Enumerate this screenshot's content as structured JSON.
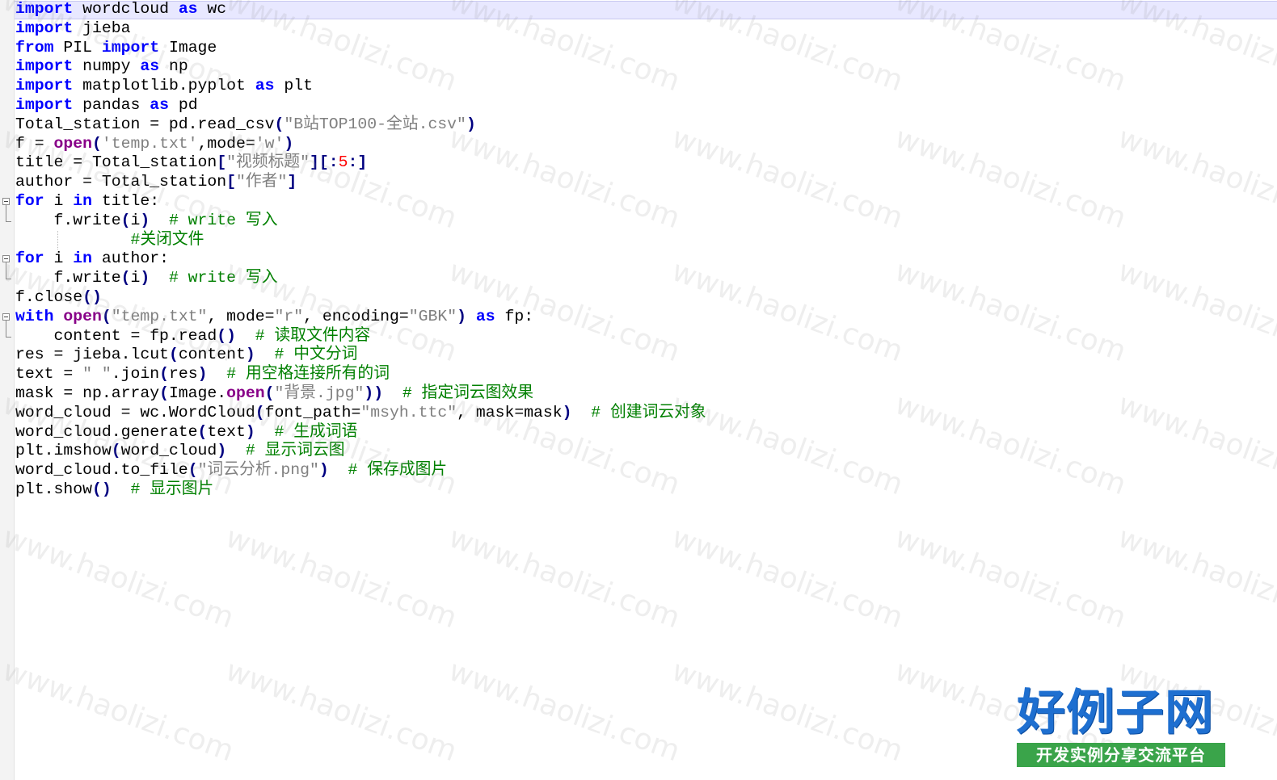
{
  "code_lines": [
    [
      {
        "t": "import",
        "c": "kw"
      },
      {
        "t": " wordcloud ",
        "c": "id"
      },
      {
        "t": "as",
        "c": "kw"
      },
      {
        "t": " wc",
        "c": "id"
      }
    ],
    [
      {
        "t": "import",
        "c": "kw"
      },
      {
        "t": " jieba",
        "c": "id"
      }
    ],
    [
      {
        "t": "from",
        "c": "kw"
      },
      {
        "t": " PIL ",
        "c": "id"
      },
      {
        "t": "import",
        "c": "kw"
      },
      {
        "t": " Image",
        "c": "id"
      }
    ],
    [
      {
        "t": "import",
        "c": "kw"
      },
      {
        "t": " numpy ",
        "c": "id"
      },
      {
        "t": "as",
        "c": "kw"
      },
      {
        "t": " np",
        "c": "id"
      }
    ],
    [
      {
        "t": "import",
        "c": "kw"
      },
      {
        "t": " matplotlib.pyplot ",
        "c": "id"
      },
      {
        "t": "as",
        "c": "kw"
      },
      {
        "t": " plt",
        "c": "id"
      }
    ],
    [
      {
        "t": "import",
        "c": "kw"
      },
      {
        "t": " pandas ",
        "c": "id"
      },
      {
        "t": "as",
        "c": "kw"
      },
      {
        "t": " pd",
        "c": "id"
      }
    ],
    [
      {
        "t": "Total_station = pd.read_csv",
        "c": "id"
      },
      {
        "t": "(",
        "c": "op"
      },
      {
        "t": "\"B站TOP100-全站.csv\"",
        "c": "str"
      },
      {
        "t": ")",
        "c": "op"
      }
    ],
    [
      {
        "t": "f = ",
        "c": "id"
      },
      {
        "t": "open",
        "c": "bi"
      },
      {
        "t": "(",
        "c": "op"
      },
      {
        "t": "'temp.txt'",
        "c": "str"
      },
      {
        "t": ",mode=",
        "c": "id"
      },
      {
        "t": "'w'",
        "c": "str"
      },
      {
        "t": ")",
        "c": "op"
      }
    ],
    [
      {
        "t": "title = Total_station",
        "c": "id"
      },
      {
        "t": "[",
        "c": "op"
      },
      {
        "t": "\"视频标题\"",
        "c": "str"
      },
      {
        "t": "][:",
        "c": "op"
      },
      {
        "t": "5",
        "c": "num"
      },
      {
        "t": ":]",
        "c": "op"
      }
    ],
    [
      {
        "t": "author = Total_station",
        "c": "id"
      },
      {
        "t": "[",
        "c": "op"
      },
      {
        "t": "\"作者\"",
        "c": "str"
      },
      {
        "t": "]",
        "c": "op"
      }
    ],
    [
      {
        "t": "for",
        "c": "kw"
      },
      {
        "t": " i ",
        "c": "id"
      },
      {
        "t": "in",
        "c": "kw"
      },
      {
        "t": " title:",
        "c": "id"
      }
    ],
    [
      {
        "t": "    f.write",
        "c": "id"
      },
      {
        "t": "(",
        "c": "op"
      },
      {
        "t": "i",
        "c": "id"
      },
      {
        "t": ")",
        "c": "op"
      },
      {
        "t": "  # write 写入",
        "c": "cm"
      }
    ],
    [
      {
        "t": "            ",
        "c": "id"
      },
      {
        "t": "#关闭文件",
        "c": "cm"
      }
    ],
    [
      {
        "t": "for",
        "c": "kw"
      },
      {
        "t": " i ",
        "c": "id"
      },
      {
        "t": "in",
        "c": "kw"
      },
      {
        "t": " author:",
        "c": "id"
      }
    ],
    [
      {
        "t": "    f.write",
        "c": "id"
      },
      {
        "t": "(",
        "c": "op"
      },
      {
        "t": "i",
        "c": "id"
      },
      {
        "t": ")",
        "c": "op"
      },
      {
        "t": "  # write 写入",
        "c": "cm"
      }
    ],
    [
      {
        "t": "f.close",
        "c": "id"
      },
      {
        "t": "()",
        "c": "op"
      }
    ],
    [
      {
        "t": "with",
        "c": "kw"
      },
      {
        "t": " ",
        "c": "id"
      },
      {
        "t": "open",
        "c": "bi"
      },
      {
        "t": "(",
        "c": "op"
      },
      {
        "t": "\"temp.txt\"",
        "c": "str"
      },
      {
        "t": ", mode=",
        "c": "id"
      },
      {
        "t": "\"r\"",
        "c": "str"
      },
      {
        "t": ", encoding=",
        "c": "id"
      },
      {
        "t": "\"GBK\"",
        "c": "str"
      },
      {
        "t": ")",
        "c": "op"
      },
      {
        "t": " ",
        "c": "id"
      },
      {
        "t": "as",
        "c": "kw"
      },
      {
        "t": " fp:",
        "c": "id"
      }
    ],
    [
      {
        "t": "    content = fp.read",
        "c": "id"
      },
      {
        "t": "()",
        "c": "op"
      },
      {
        "t": "  # 读取文件内容",
        "c": "cm"
      }
    ],
    [
      {
        "t": "res = jieba.lcut",
        "c": "id"
      },
      {
        "t": "(",
        "c": "op"
      },
      {
        "t": "content",
        "c": "id"
      },
      {
        "t": ")",
        "c": "op"
      },
      {
        "t": "  # 中文分词",
        "c": "cm"
      }
    ],
    [
      {
        "t": "text = ",
        "c": "id"
      },
      {
        "t": "\" \"",
        "c": "str"
      },
      {
        "t": ".join",
        "c": "id"
      },
      {
        "t": "(",
        "c": "op"
      },
      {
        "t": "res",
        "c": "id"
      },
      {
        "t": ")",
        "c": "op"
      },
      {
        "t": "  # 用空格连接所有的词",
        "c": "cm"
      }
    ],
    [
      {
        "t": "mask = np.array",
        "c": "id"
      },
      {
        "t": "(",
        "c": "op"
      },
      {
        "t": "Image.",
        "c": "id"
      },
      {
        "t": "open",
        "c": "bi"
      },
      {
        "t": "(",
        "c": "op"
      },
      {
        "t": "\"背景.jpg\"",
        "c": "str"
      },
      {
        "t": "))",
        "c": "op"
      },
      {
        "t": "  # 指定词云图效果",
        "c": "cm"
      }
    ],
    [
      {
        "t": "word_cloud = wc.WordCloud",
        "c": "id"
      },
      {
        "t": "(",
        "c": "op"
      },
      {
        "t": "font_path=",
        "c": "id"
      },
      {
        "t": "\"msyh.ttc\"",
        "c": "str"
      },
      {
        "t": ", mask=mask",
        "c": "id"
      },
      {
        "t": ")",
        "c": "op"
      },
      {
        "t": "  # 创建词云对象",
        "c": "cm"
      }
    ],
    [
      {
        "t": "word_cloud.generate",
        "c": "id"
      },
      {
        "t": "(",
        "c": "op"
      },
      {
        "t": "text",
        "c": "id"
      },
      {
        "t": ")",
        "c": "op"
      },
      {
        "t": "  # 生成词语",
        "c": "cm"
      }
    ],
    [
      {
        "t": "plt.imshow",
        "c": "id"
      },
      {
        "t": "(",
        "c": "op"
      },
      {
        "t": "word_cloud",
        "c": "id"
      },
      {
        "t": ")",
        "c": "op"
      },
      {
        "t": "  # 显示词云图",
        "c": "cm"
      }
    ],
    [
      {
        "t": "word_cloud.to_file",
        "c": "id"
      },
      {
        "t": "(",
        "c": "op"
      },
      {
        "t": "\"词云分析.png\"",
        "c": "str"
      },
      {
        "t": ")",
        "c": "op"
      },
      {
        "t": "  # 保存成图片",
        "c": "cm"
      }
    ],
    [
      {
        "t": "plt.show",
        "c": "id"
      },
      {
        "t": "()",
        "c": "op"
      },
      {
        "t": "  # 显示图片",
        "c": "cm"
      }
    ]
  ],
  "watermark": {
    "text": "www.haolizi.com"
  },
  "logo": {
    "title": "好例子网",
    "subtitle": "开发实例分享交流平台"
  },
  "colors": {
    "keyword": "#0000ff",
    "builtin": "#880088",
    "string": "#808080",
    "number": "#ff0000",
    "operator": "#000080",
    "comment": "#008000",
    "current_line": "#e8e8ff",
    "logo_blue": "#1e6fd0",
    "logo_green": "#3aa44a"
  }
}
